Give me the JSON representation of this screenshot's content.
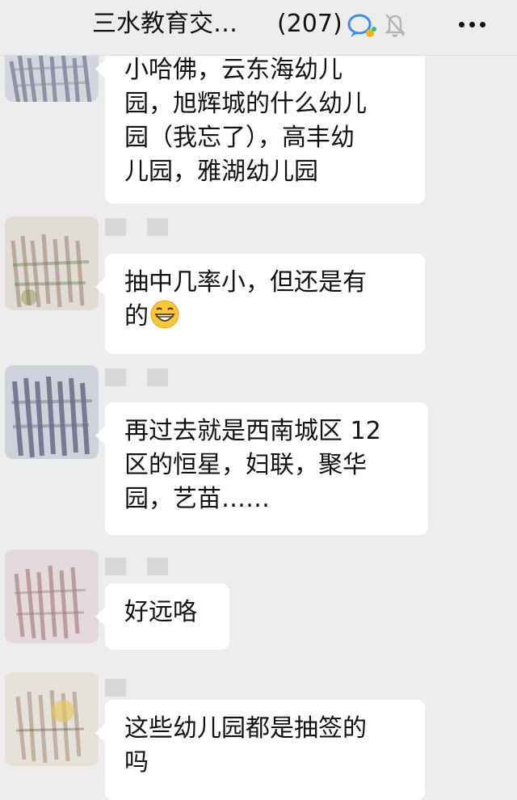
{
  "header": {
    "title": "三水教育交…",
    "member_count": "(207)",
    "icons": [
      "chat-bubble-icon",
      "mute-bell-icon",
      "more-icon"
    ]
  },
  "messages": [
    {
      "lines": [
        "小哈佛，云东海幼儿",
        "园，旭辉城的什么幼儿",
        "园（我忘了），高丰幼",
        "儿园，雅湖幼儿园"
      ]
    },
    {
      "lines": [
        "抽中几率小，但还是有",
        "的"
      ],
      "emoji": "grinning-face-icon"
    },
    {
      "lines": [
        "再过去就是西南城区 12",
        "区的恒星，妇联，聚华",
        "园，艺苗……"
      ]
    },
    {
      "lines": [
        "好远咯"
      ]
    },
    {
      "lines": [
        "这些幼儿园都是抽签的",
        "吗"
      ]
    }
  ],
  "colors": {
    "background": "#ededed",
    "bubble": "#ffffff",
    "text": "#111111"
  }
}
